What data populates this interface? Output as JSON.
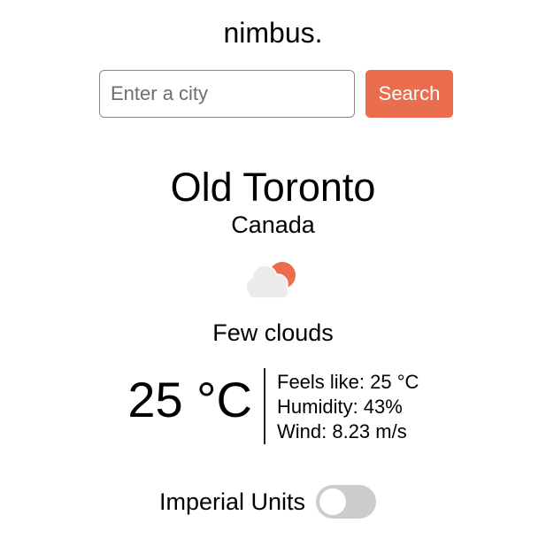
{
  "app": {
    "title": "nimbus."
  },
  "search": {
    "placeholder": "Enter a city",
    "value": "",
    "button_label": "Search"
  },
  "location": {
    "city": "Old Toronto",
    "country": "Canada"
  },
  "weather": {
    "icon": "few-clouds-day-icon",
    "description": "Few clouds",
    "temperature": "25 °C",
    "feels_like": "Feels like: 25 °C",
    "humidity": "Humidity: 43%",
    "wind": "Wind: 8.23 m/s"
  },
  "settings": {
    "imperial_label": "Imperial Units",
    "imperial_enabled": false
  },
  "colors": {
    "accent": "#ea6d4e",
    "cloud": "#ebebeb",
    "toggle_off": "#cccccc"
  }
}
